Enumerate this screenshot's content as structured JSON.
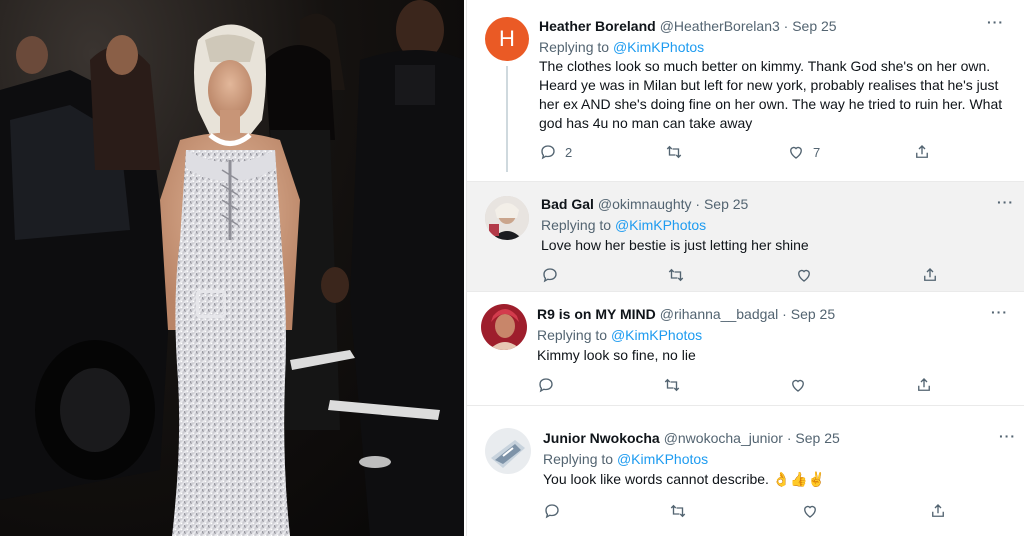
{
  "tweets": [
    {
      "avatar_letter": "H",
      "name": "Heather Boreland",
      "handle": "@HeatherBorelan3",
      "date": "Sep 25",
      "replying_label": "Replying to",
      "replying_to": "@KimKPhotos",
      "text": "The clothes look so much better on kimmy. Thank God she's on her own. Heard ye was in Milan but left for new york, probably realises that he's just her ex AND she's doing fine on her own. The way he tried to ruin her. What god has 4u no man can take away",
      "replies": "2",
      "likes": "7"
    },
    {
      "name": "Bad Gal",
      "handle": "@okimnaughty",
      "date": "Sep 25",
      "replying_label": "Replying to",
      "replying_to": "@KimKPhotos",
      "text": "Love how her bestie is just letting her shine"
    },
    {
      "name": "R9 is on MY MIND",
      "handle": "@rihanna__badgal",
      "date": "Sep 25",
      "replying_label": "Replying to",
      "replying_to": "@KimKPhotos",
      "text": "Kimmy look so fine, no lie"
    },
    {
      "name": "Junior Nwokocha",
      "handle": "@nwokocha_junior",
      "date": "Sep 25",
      "replying_label": "Replying to",
      "replying_to": "@KimKPhotos",
      "text": "You look like words cannot describe.",
      "emoji": "👌👍✌"
    }
  ],
  "icons": {
    "reply": "reply-icon",
    "retweet": "retweet-icon",
    "like": "like-icon",
    "share": "share-icon",
    "more": "more-icon"
  },
  "colors": {
    "link": "#1d9bf0",
    "avatar_h": "#ea5a25",
    "muted": "#536471"
  }
}
